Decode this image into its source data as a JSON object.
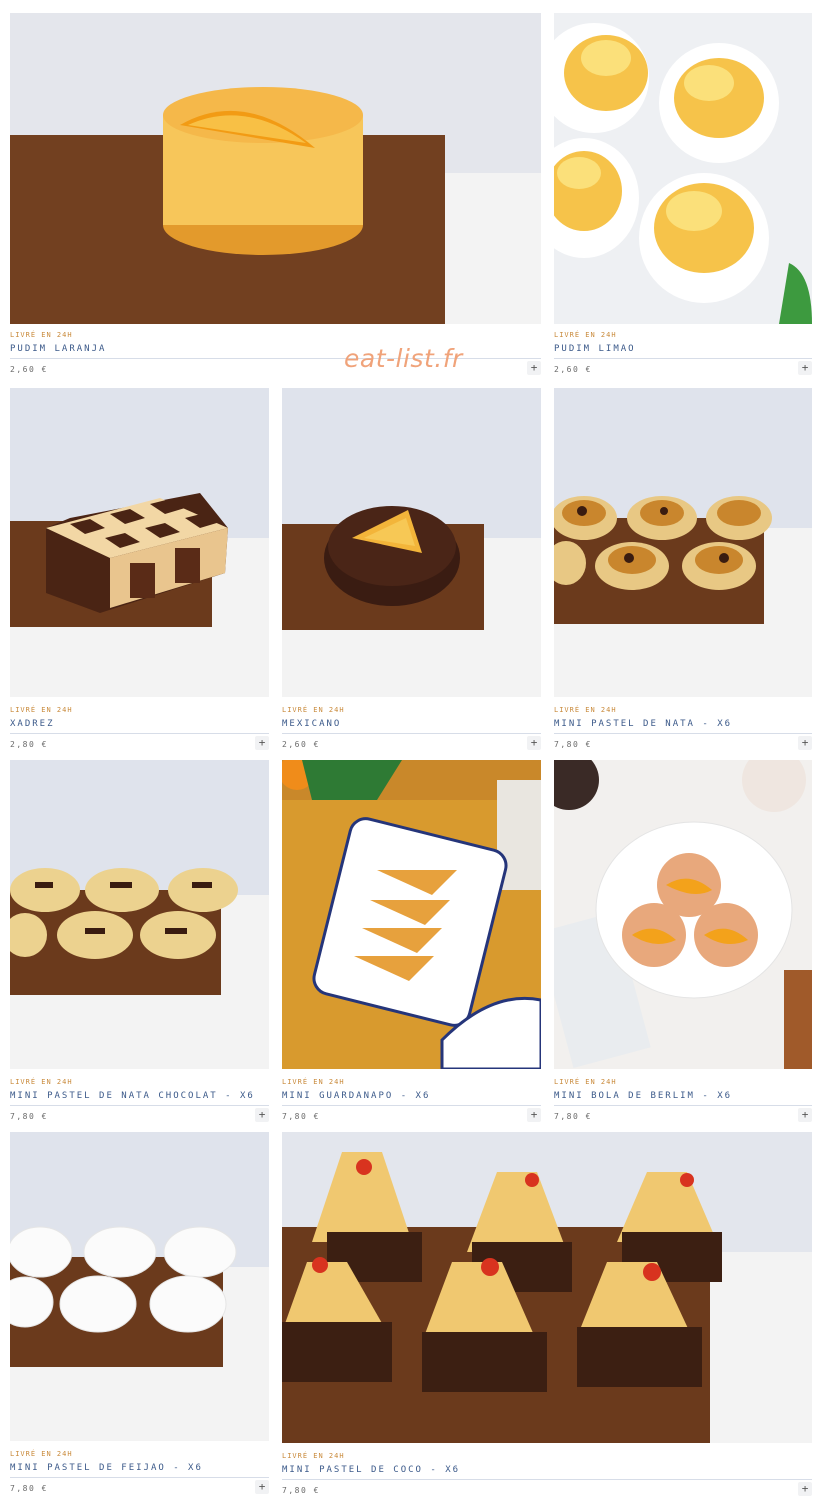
{
  "watermark": "eat-list.fr",
  "delivery_label": "LIVRÉ EN 24H",
  "add_symbol": "+",
  "products": [
    {
      "name": "PUDIM LARANJA",
      "price": "2,60 €"
    },
    {
      "name": "PUDIM LIMAO",
      "price": "2,60 €"
    },
    {
      "name": "XADREZ",
      "price": "2,80 €"
    },
    {
      "name": "MEXICANO",
      "price": "2,60 €"
    },
    {
      "name": "MINI PASTEL DE NATA - X6",
      "price": "7,80 €"
    },
    {
      "name": "MINI PASTEL DE NATA CHOCOLAT - X6",
      "price": "7,80 €"
    },
    {
      "name": "MINI GUARDANAPO - X6",
      "price": "7,80 €"
    },
    {
      "name": "MINI BOLA DE BERLIM - X6",
      "price": "7,80 €"
    },
    {
      "name": "MINI PASTEL DE FEIJAO - X6",
      "price": "7,80 €"
    },
    {
      "name": "MINI PASTEL DE COCO - X6",
      "price": "7,80 €"
    }
  ],
  "colors": {
    "accent": "#c98a3b",
    "title": "#3c5a8a",
    "price": "#6a6a6a",
    "watermark": "#f0a37a"
  }
}
